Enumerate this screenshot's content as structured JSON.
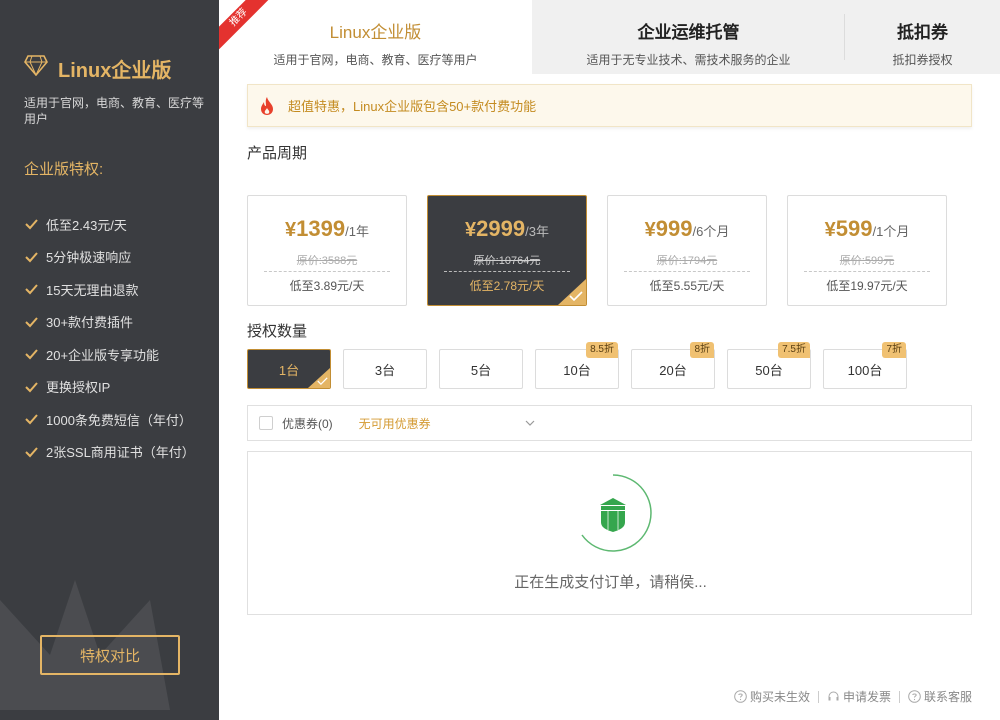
{
  "sidebar": {
    "title": "Linux企业版",
    "description": "适用于官网，电商、教育、医疗等用户",
    "privileges_heading": "企业版特权:",
    "privileges": [
      "低至2.43元/天",
      "5分钟极速响应",
      "15天无理由退款",
      "30+款付费插件",
      "20+企业版专享功能",
      "更换授权IP",
      "1000条免费短信（年付）",
      "2张SSL商用证书（年付）"
    ],
    "compare_button": "特权对比"
  },
  "tabs": [
    {
      "title": "Linux企业版",
      "subtitle": "适用于官网，电商、教育、医疗等用户",
      "badge": "推荐",
      "active": true
    },
    {
      "title": "企业运维托管",
      "subtitle": "适用于无专业技术、需技术服务的企业",
      "active": false
    },
    {
      "title": "抵扣券",
      "subtitle": "抵扣券授权",
      "active": false
    }
  ],
  "notice": "超值特惠，Linux企业版包含50+款付费功能",
  "period": {
    "label": "产品周期",
    "currency": "¥",
    "options": [
      {
        "price": "1399",
        "unit": "/1年",
        "original": "原价:3588元",
        "daily": "低至3.89元/天",
        "selected": false
      },
      {
        "price": "2999",
        "unit": "/3年",
        "original": "原价:10764元",
        "daily": "低至2.78元/天",
        "selected": true
      },
      {
        "price": "999",
        "unit": "/6个月",
        "original": "原价:1794元",
        "daily": "低至5.55元/天",
        "selected": false
      },
      {
        "price": "599",
        "unit": "/1个月",
        "original": "原价:599元",
        "daily": "低至19.97元/天",
        "selected": false
      }
    ]
  },
  "quantity": {
    "label": "授权数量",
    "options": [
      {
        "label": "1台",
        "discount": "",
        "selected": true
      },
      {
        "label": "3台",
        "discount": "",
        "selected": false
      },
      {
        "label": "5台",
        "discount": "",
        "selected": false
      },
      {
        "label": "10台",
        "discount": "8.5折",
        "selected": false
      },
      {
        "label": "20台",
        "discount": "8折",
        "selected": false
      },
      {
        "label": "50台",
        "discount": "7.5折",
        "selected": false
      },
      {
        "label": "100台",
        "discount": "7折",
        "selected": false
      }
    ]
  },
  "coupon": {
    "label": "优惠券(0)",
    "selected_text": "无可用优惠券"
  },
  "payment": {
    "status": "正在生成支付订单，请稍侯..."
  },
  "footer": {
    "not_effective": "购买未生效",
    "invoice": "申请发票",
    "support": "联系客服"
  },
  "colors": {
    "sidebar_bg": "#3b3d41",
    "gold": "#e4b565",
    "accent": "#c28e34",
    "ribbon": "#e4322f",
    "spinner_green": "#35a64d"
  },
  "icons": {
    "logo": "diamond-icon",
    "check": "check-icon",
    "notice": "fire-icon",
    "spinner": "shield-icon",
    "footer": "question-circle-icon"
  }
}
